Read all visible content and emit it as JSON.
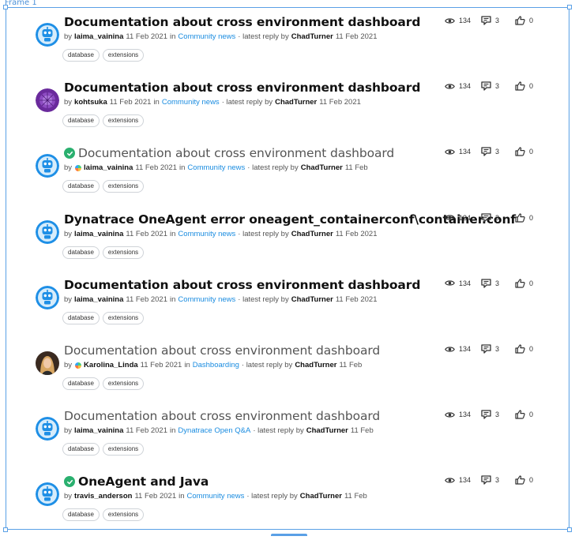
{
  "frame": {
    "label": "Frame 1"
  },
  "tags": [
    "database",
    "extensions"
  ],
  "posts": [
    {
      "title": "Documentation about cross environment dashboard",
      "solved": false,
      "bold": true,
      "by": "by",
      "author": "laima_vainina",
      "author_badge": false,
      "posted": "11 Feb 2021",
      "in": "in",
      "category": "Community news",
      "latest": "· latest reply by",
      "reply_user": "ChadTurner",
      "reply_date": "11 Feb 2021",
      "avatar": "robot",
      "views": "134",
      "replies": "3",
      "likes": "0"
    },
    {
      "title": "Documentation about cross environment dashboard",
      "solved": false,
      "bold": true,
      "by": "by",
      "author": "kohtsuka",
      "author_badge": false,
      "posted": "11 Feb 2021",
      "in": "in",
      "category": "Community news",
      "latest": "· latest reply by",
      "reply_user": "ChadTurner",
      "reply_date": "11 Feb 2021",
      "avatar": "purple-pattern",
      "views": "134",
      "replies": "3",
      "likes": "0"
    },
    {
      "title": "Documentation about cross environment dashboard",
      "solved": true,
      "bold": false,
      "by": "by",
      "author": "laima_vainina",
      "author_badge": true,
      "posted": "11 Feb 2021",
      "in": "in",
      "category": "Community news",
      "latest": "· latest reply by",
      "reply_user": "ChadTurner",
      "reply_date": "11 Feb",
      "avatar": "robot",
      "views": "134",
      "replies": "3",
      "likes": "0"
    },
    {
      "title": "Dynatrace OneAgent error oneagent_containerconf\\container.conf",
      "solved": false,
      "bold": true,
      "by": "by",
      "author": "laima_vainina",
      "author_badge": false,
      "posted": "11 Feb 2021",
      "in": "in",
      "category": "Community news",
      "latest": "· latest reply by",
      "reply_user": "ChadTurner",
      "reply_date": "11 Feb 2021",
      "avatar": "robot",
      "views": "134",
      "replies": "3",
      "likes": "0"
    },
    {
      "title": "Documentation about cross environment dashboard",
      "solved": false,
      "bold": true,
      "by": "by",
      "author": "laima_vainina",
      "author_badge": false,
      "posted": "11 Feb 2021",
      "in": "in",
      "category": "Community news",
      "latest": "· latest reply by",
      "reply_user": "ChadTurner",
      "reply_date": "11 Feb 2021",
      "avatar": "robot",
      "views": "134",
      "replies": "3",
      "likes": "0"
    },
    {
      "title": "Documentation about cross environment dashboard",
      "solved": false,
      "bold": false,
      "by": "by",
      "author": "Karolina_Linda",
      "author_badge": true,
      "posted": "11 Feb 2021",
      "in": "in",
      "category": "Dashboarding",
      "latest": "· latest reply by",
      "reply_user": "ChadTurner",
      "reply_date": "11 Feb",
      "avatar": "photo",
      "views": "134",
      "replies": "3",
      "likes": "0"
    },
    {
      "title": "Documentation about cross environment dashboard",
      "solved": false,
      "bold": false,
      "by": "by",
      "author": "laima_vainina",
      "author_badge": false,
      "posted": "11 Feb 2021",
      "in": "in",
      "category": "Dynatrace Open Q&A",
      "latest": "· latest reply by",
      "reply_user": "ChadTurner",
      "reply_date": "11 Feb",
      "avatar": "robot",
      "views": "134",
      "replies": "3",
      "likes": "0"
    },
    {
      "title": "OneAgent and Java",
      "solved": true,
      "bold": true,
      "by": "by",
      "author": "travis_anderson",
      "author_badge": false,
      "posted": "11 Feb 2021",
      "in": "in",
      "category": "Community news",
      "latest": "· latest reply by",
      "reply_user": "ChadTurner",
      "reply_date": "11 Feb",
      "avatar": "robot",
      "views": "134",
      "replies": "3",
      "likes": "0"
    }
  ],
  "icons": {
    "views": "eye-icon",
    "replies": "comment-icon",
    "likes": "thumbs-up-icon",
    "solved": "check-circle-icon"
  },
  "colors": {
    "accent": "#1a8ce0",
    "solved": "#2ab06f",
    "frame": "#5aa0e6"
  }
}
